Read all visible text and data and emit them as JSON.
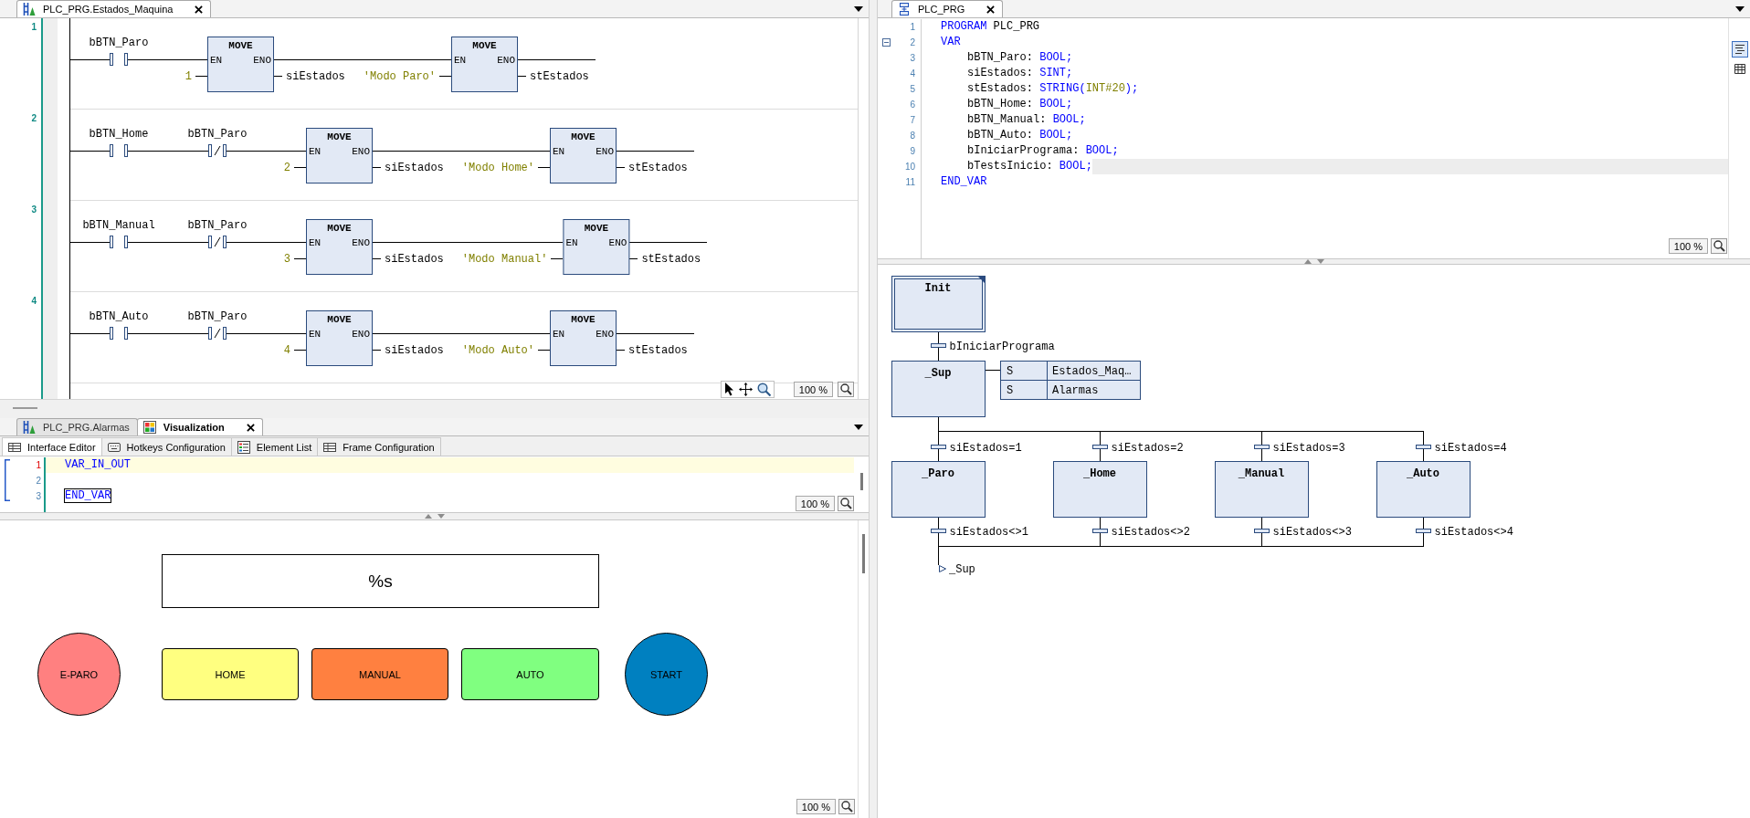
{
  "ladder_pane": {
    "focused": false,
    "tabs": [
      {
        "title": "PLC_PRG.Estados_Maquina",
        "kind": "ladder",
        "selected": true
      }
    ],
    "networks": [
      {
        "number": "1",
        "contacts": [
          {
            "variable": "bBTN_Paro",
            "negated": false
          }
        ],
        "blocks": [
          {
            "title": "MOVE",
            "en": "EN",
            "eno": "ENO",
            "input": "1",
            "output": "siEstados"
          },
          {
            "title": "MOVE",
            "en": "EN",
            "eno": "ENO",
            "input": "'Modo Paro'",
            "output": "stEstados"
          }
        ]
      },
      {
        "number": "2",
        "contacts": [
          {
            "variable": "bBTN_Home",
            "negated": false
          },
          {
            "variable": "bBTN_Paro",
            "negated": true
          }
        ],
        "blocks": [
          {
            "title": "MOVE",
            "en": "EN",
            "eno": "ENO",
            "input": "2",
            "output": "siEstados"
          },
          {
            "title": "MOVE",
            "en": "EN",
            "eno": "ENO",
            "input": "'Modo Home'",
            "output": "stEstados"
          }
        ]
      },
      {
        "number": "3",
        "contacts": [
          {
            "variable": "bBTN_Manual",
            "negated": false
          },
          {
            "variable": "bBTN_Paro",
            "negated": true
          }
        ],
        "blocks": [
          {
            "title": "MOVE",
            "en": "EN",
            "eno": "ENO",
            "input": "3",
            "output": "siEstados"
          },
          {
            "title": "MOVE",
            "en": "EN",
            "eno": "ENO",
            "input": "'Modo Manual'",
            "output": "stEstados"
          }
        ]
      },
      {
        "number": "4",
        "contacts": [
          {
            "variable": "bBTN_Auto",
            "negated": false
          },
          {
            "variable": "bBTN_Paro",
            "negated": true
          }
        ],
        "blocks": [
          {
            "title": "MOVE",
            "en": "EN",
            "eno": "ENO",
            "input": "4",
            "output": "siEstados"
          },
          {
            "title": "MOVE",
            "en": "EN",
            "eno": "ENO",
            "input": "'Modo Auto'",
            "output": "stEstados"
          }
        ]
      }
    ],
    "zoom": "100 %"
  },
  "visualization_pane": {
    "focused": true,
    "tabs": [
      {
        "title": "PLC_PRG.Alarmas",
        "kind": "ladder",
        "selected": false
      },
      {
        "title": "Visualization",
        "kind": "visualization",
        "selected": true
      }
    ],
    "subtabs": [
      {
        "label": "Interface Editor",
        "kind": "table",
        "selected": true
      },
      {
        "label": "Hotkeys Configuration",
        "kind": "keyboard",
        "selected": false
      },
      {
        "label": "Element List",
        "kind": "list",
        "selected": false
      },
      {
        "label": "Frame Configuration",
        "kind": "table",
        "selected": false
      }
    ],
    "interface_lines": [
      {
        "number": "1",
        "current": true,
        "segments": [
          {
            "kind": "keyword",
            "text": "VAR_IN_OUT",
            "boxed": false
          }
        ]
      },
      {
        "number": "2",
        "current": false
      },
      {
        "number": "3",
        "current": false,
        "segments": [
          {
            "kind": "keyword",
            "text": "END_VAR",
            "boxed": true
          }
        ]
      }
    ],
    "interface_zoom": "100 %",
    "elements": [
      {
        "kind": "text_field",
        "text": "%s"
      },
      {
        "kind": "round_button",
        "text": "E-PARO",
        "color": "#ff8080"
      },
      {
        "kind": "rect_button",
        "text": "HOME",
        "color": "#ffff80"
      },
      {
        "kind": "rect_button",
        "text": "MANUAL",
        "color": "#ff8040"
      },
      {
        "kind": "rect_button",
        "text": "AUTO",
        "color": "#80ff80"
      },
      {
        "kind": "round_button",
        "text": "START",
        "color": "#0080c0"
      }
    ],
    "zoom": "100 %"
  },
  "code_pane": {
    "focused": false,
    "tabs": [
      {
        "title": "PLC_PRG",
        "kind": "sfc",
        "selected": true
      }
    ],
    "lines": [
      {
        "number": "1",
        "current": false,
        "segments": [
          {
            "kind": "keyword",
            "text": "PROGRAM"
          },
          {
            "kind": "plain",
            "text": " PLC_PRG"
          }
        ]
      },
      {
        "number": "2",
        "current": false,
        "expanded": true,
        "segments": [
          {
            "kind": "keyword",
            "text": "VAR"
          }
        ],
        "children": [
          {
            "number": "3",
            "current": false,
            "segments": [
              {
                "kind": "plain",
                "text": "bBTN_Paro: "
              },
              {
                "kind": "keyword",
                "text": "BOOL;"
              }
            ]
          },
          {
            "number": "4",
            "current": false,
            "segments": [
              {
                "kind": "plain",
                "text": "siEstados: "
              },
              {
                "kind": "keyword",
                "text": "SINT;"
              }
            ]
          },
          {
            "number": "5",
            "current": false,
            "segments": [
              {
                "kind": "plain",
                "text": "stEstados: "
              },
              {
                "kind": "keyword",
                "text": "STRING("
              },
              {
                "kind": "literal",
                "text": "INT#20"
              },
              {
                "kind": "keyword",
                "text": ");"
              }
            ]
          },
          {
            "number": "6",
            "current": false,
            "segments": [
              {
                "kind": "plain",
                "text": "bBTN_Home: "
              },
              {
                "kind": "keyword",
                "text": "BOOL;"
              }
            ]
          },
          {
            "number": "7",
            "current": false,
            "segments": [
              {
                "kind": "plain",
                "text": "bBTN_Manual: "
              },
              {
                "kind": "keyword",
                "text": "BOOL;"
              }
            ]
          },
          {
            "number": "8",
            "current": false,
            "segments": [
              {
                "kind": "plain",
                "text": "bBTN_Auto: "
              },
              {
                "kind": "keyword",
                "text": "BOOL;"
              }
            ]
          },
          {
            "number": "9",
            "current": false,
            "segments": [
              {
                "kind": "plain",
                "text": "bIniciarPrograma: "
              },
              {
                "kind": "keyword",
                "text": "BOOL;"
              }
            ]
          },
          {
            "number": "10",
            "current": true,
            "segments": [
              {
                "kind": "plain",
                "text": "bTestsInicio: "
              },
              {
                "kind": "keyword",
                "text": "BOOL;"
              }
            ]
          }
        ]
      },
      {
        "number": "11",
        "current": false,
        "segments": [
          {
            "kind": "keyword",
            "text": "END_VAR"
          }
        ]
      }
    ],
    "view_buttons": [
      {
        "kind": "text",
        "selected": true
      },
      {
        "kind": "table",
        "selected": false
      }
    ],
    "zoom": "100 %"
  },
  "sfc_pane": {
    "start": {
      "name": "Init",
      "initial": true
    },
    "start_transition": "bIniciarPrograma",
    "main": {
      "name": "_Sup",
      "initial": false,
      "actions": [
        {
          "qualifier": "S",
          "name": "Estados_Maq…"
        },
        {
          "qualifier": "S",
          "name": "Alarmas"
        }
      ]
    },
    "branches": [
      {
        "entry": "siEstados=1",
        "step": {
          "name": "_Paro",
          "initial": false
        },
        "exit": "siEstados<>1"
      },
      {
        "entry": "siEstados=2",
        "step": {
          "name": "_Home",
          "initial": false
        },
        "exit": "siEstados<>2"
      },
      {
        "entry": "siEstados=3",
        "step": {
          "name": "_Manual",
          "initial": false
        },
        "exit": "siEstados<>3"
      },
      {
        "entry": "siEstados=4",
        "step": {
          "name": "_Auto",
          "initial": false
        },
        "exit": "siEstados<>4"
      }
    ],
    "jump": "_Sup"
  }
}
